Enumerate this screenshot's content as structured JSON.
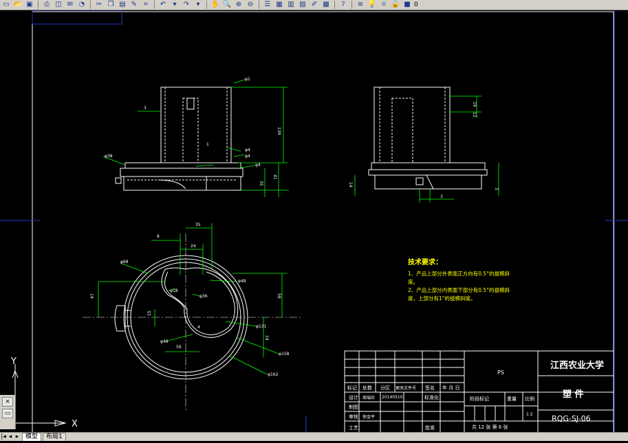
{
  "toolbar": {
    "icons": [
      "new-icon",
      "open-icon",
      "save-icon",
      "print-icon",
      "plot-preview-icon",
      "publish-icon",
      "cut-icon",
      "copy-icon",
      "paste-icon",
      "match-properties-icon",
      "block-editor-icon",
      "undo-icon",
      "redo-icon",
      "pan-icon",
      "zoom-realtime-icon",
      "zoom-window-icon",
      "zoom-previous-icon",
      "properties-icon",
      "design-center-icon",
      "tool-palettes-icon",
      "sheet-set-icon",
      "markup-icon",
      "calculator-icon",
      "help-icon",
      "layer-properties-icon",
      "layer-state-icon"
    ],
    "layer_value": "0"
  },
  "drawing": {
    "front_view": {
      "labels": {
        "d1": "φ1",
        "t3": "3",
        "d4a": "φ4",
        "d4b": "φ4",
        "d4c": "φ4",
        "d38": "φ38",
        "h239": "239",
        "h35": "35",
        "h41": "41",
        "one": "1"
      }
    },
    "side_view": {
      "labels": {
        "h19": "19",
        "h12": "12",
        "h14": "14",
        "h3a": "3",
        "h3b": "3",
        "w3": "3"
      }
    },
    "top_view": {
      "labels": {
        "w35": "35",
        "w8": "8",
        "w24": "24",
        "d68": "φ68",
        "d48": "φ48",
        "d18": "φ18",
        "d36": "φ36",
        "h47": "47",
        "h15": "15",
        "h4": "4",
        "h58": "58",
        "d131": "φ131",
        "h24": "24",
        "d49": "φ49",
        "w56": "56",
        "d158": "φ158",
        "d162": "φ162"
      }
    },
    "tech_requirements": {
      "title": "技术要求：",
      "lines": [
        "1、产品上部分外表面正方向有0.5°的拔模斜",
        "度。",
        "2、产品上部分内表面下部分有0.5°的拔模斜",
        "度，上部分有1°的拔模斜度。"
      ]
    },
    "ucs": {
      "x": "X",
      "y": "Y"
    }
  },
  "title_block": {
    "material": "PS",
    "university": "江西农业大学",
    "part_name": "塑 件",
    "drawing_no": "RQG-SJ-06",
    "scale": "1:2",
    "sheets": "共 12 张  第 6 张",
    "headers": {
      "mark": "标记",
      "count": "处数",
      "zone": "分区",
      "change_doc": "更改文件号",
      "signature": "签名",
      "date": "年 月 日",
      "design": "设计",
      "standardization": "标准化",
      "draw": "制图",
      "check": "审核",
      "craft": "工艺",
      "approve": "批准",
      "stage_mark": "阶段标记",
      "weight": "重量",
      "ratio": "比例"
    },
    "designer": "周瑞珍",
    "design_date": "20140510",
    "checker": "徐金平"
  },
  "tabs": {
    "model": "模型",
    "layout": "布局1"
  }
}
